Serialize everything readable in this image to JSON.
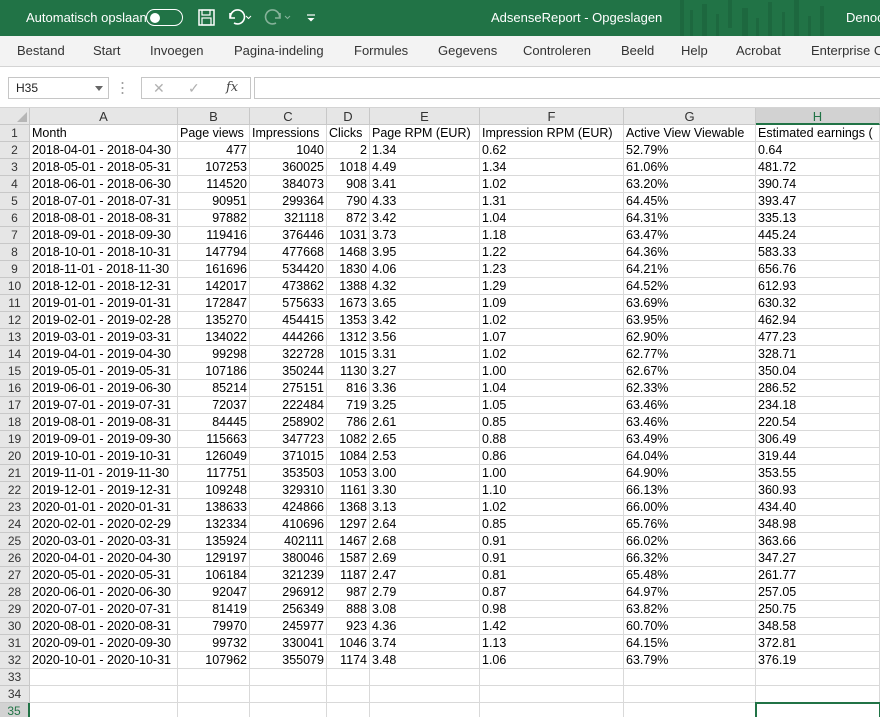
{
  "titlebar": {
    "autosave_label": "Automatisch opslaan",
    "autosave_state": "off",
    "title": "AdsenseReport  -  Opgeslagen",
    "user": "Denoc",
    "icons": [
      "save-icon",
      "undo-icon",
      "redo-icon",
      "customize-quick-access-icon"
    ],
    "color": "#217346"
  },
  "ribbon": {
    "tabs": [
      "Bestand",
      "Start",
      "Invoegen",
      "Pagina-indeling",
      "Formules",
      "Gegevens",
      "Controleren",
      "Beeld",
      "Help",
      "Acrobat",
      "Enterprise C"
    ]
  },
  "formula_bar": {
    "name_box": "H35",
    "cancel_symbol": "✕",
    "enter_symbol": "✓",
    "fx_symbol": "fx",
    "content": ""
  },
  "sheet": {
    "selected_cell": "H35",
    "columns": [
      "A",
      "B",
      "C",
      "D",
      "E",
      "F",
      "G",
      "H"
    ],
    "row_numbers": [
      "1",
      "2",
      "3",
      "4",
      "5",
      "6",
      "7",
      "8",
      "9",
      "10",
      "11",
      "12",
      "13",
      "14",
      "15",
      "16",
      "17",
      "18",
      "19",
      "20",
      "21",
      "22",
      "23",
      "24",
      "25",
      "26",
      "27",
      "28",
      "29",
      "30",
      "31",
      "32",
      "33",
      "34",
      "35"
    ],
    "headers": [
      "Month",
      "Page views",
      "Impressions",
      "Clicks",
      "Page RPM (EUR)",
      "Impression RPM (EUR)",
      "Active View Viewable",
      "Estimated earnings ("
    ],
    "rows": [
      [
        "2018-04-01 - 2018-04-30",
        "477",
        "1040",
        "2",
        "1.34",
        "0.62",
        "52.79%",
        "0.64"
      ],
      [
        "2018-05-01 - 2018-05-31",
        "107253",
        "360025",
        "1018",
        "4.49",
        "1.34",
        "61.06%",
        "481.72"
      ],
      [
        "2018-06-01 - 2018-06-30",
        "114520",
        "384073",
        "908",
        "3.41",
        "1.02",
        "63.20%",
        "390.74"
      ],
      [
        "2018-07-01 - 2018-07-31",
        "90951",
        "299364",
        "790",
        "4.33",
        "1.31",
        "64.45%",
        "393.47"
      ],
      [
        "2018-08-01 - 2018-08-31",
        "97882",
        "321118",
        "872",
        "3.42",
        "1.04",
        "64.31%",
        "335.13"
      ],
      [
        "2018-09-01 - 2018-09-30",
        "119416",
        "376446",
        "1031",
        "3.73",
        "1.18",
        "63.47%",
        "445.24"
      ],
      [
        "2018-10-01 - 2018-10-31",
        "147794",
        "477668",
        "1468",
        "3.95",
        "1.22",
        "64.36%",
        "583.33"
      ],
      [
        "2018-11-01 - 2018-11-30",
        "161696",
        "534420",
        "1830",
        "4.06",
        "1.23",
        "64.21%",
        "656.76"
      ],
      [
        "2018-12-01 - 2018-12-31",
        "142017",
        "473862",
        "1388",
        "4.32",
        "1.29",
        "64.52%",
        "612.93"
      ],
      [
        "2019-01-01 - 2019-01-31",
        "172847",
        "575633",
        "1673",
        "3.65",
        "1.09",
        "63.69%",
        "630.32"
      ],
      [
        "2019-02-01 - 2019-02-28",
        "135270",
        "454415",
        "1353",
        "3.42",
        "1.02",
        "63.95%",
        "462.94"
      ],
      [
        "2019-03-01 - 2019-03-31",
        "134022",
        "444266",
        "1312",
        "3.56",
        "1.07",
        "62.90%",
        "477.23"
      ],
      [
        "2019-04-01 - 2019-04-30",
        "99298",
        "322728",
        "1015",
        "3.31",
        "1.02",
        "62.77%",
        "328.71"
      ],
      [
        "2019-05-01 - 2019-05-31",
        "107186",
        "350244",
        "1130",
        "3.27",
        "1.00",
        "62.67%",
        "350.04"
      ],
      [
        "2019-06-01 - 2019-06-30",
        "85214",
        "275151",
        "816",
        "3.36",
        "1.04",
        "62.33%",
        "286.52"
      ],
      [
        "2019-07-01 - 2019-07-31",
        "72037",
        "222484",
        "719",
        "3.25",
        "1.05",
        "63.46%",
        "234.18"
      ],
      [
        "2019-08-01 - 2019-08-31",
        "84445",
        "258902",
        "786",
        "2.61",
        "0.85",
        "63.46%",
        "220.54"
      ],
      [
        "2019-09-01 - 2019-09-30",
        "115663",
        "347723",
        "1082",
        "2.65",
        "0.88",
        "63.49%",
        "306.49"
      ],
      [
        "2019-10-01 - 2019-10-31",
        "126049",
        "371015",
        "1084",
        "2.53",
        "0.86",
        "64.04%",
        "319.44"
      ],
      [
        "2019-11-01 - 2019-11-30",
        "117751",
        "353503",
        "1053",
        "3.00",
        "1.00",
        "64.90%",
        "353.55"
      ],
      [
        "2019-12-01 - 2019-12-31",
        "109248",
        "329310",
        "1161",
        "3.30",
        "1.10",
        "66.13%",
        "360.93"
      ],
      [
        "2020-01-01 - 2020-01-31",
        "138633",
        "424866",
        "1368",
        "3.13",
        "1.02",
        "66.00%",
        "434.40"
      ],
      [
        "2020-02-01 - 2020-02-29",
        "132334",
        "410696",
        "1297",
        "2.64",
        "0.85",
        "65.76%",
        "348.98"
      ],
      [
        "2020-03-01 - 2020-03-31",
        "135924",
        "402111",
        "1467",
        "2.68",
        "0.91",
        "66.02%",
        "363.66"
      ],
      [
        "2020-04-01 - 2020-04-30",
        "129197",
        "380046",
        "1587",
        "2.69",
        "0.91",
        "66.32%",
        "347.27"
      ],
      [
        "2020-05-01 - 2020-05-31",
        "106184",
        "321239",
        "1187",
        "2.47",
        "0.81",
        "65.48%",
        "261.77"
      ],
      [
        "2020-06-01 - 2020-06-30",
        "92047",
        "296912",
        "987",
        "2.79",
        "0.87",
        "64.97%",
        "257.05"
      ],
      [
        "2020-07-01 - 2020-07-31",
        "81419",
        "256349",
        "888",
        "3.08",
        "0.98",
        "63.82%",
        "250.75"
      ],
      [
        "2020-08-01 - 2020-08-31",
        "79970",
        "245977",
        "923",
        "4.36",
        "1.42",
        "60.70%",
        "348.58"
      ],
      [
        "2020-09-01 - 2020-09-30",
        "99732",
        "330041",
        "1046",
        "3.74",
        "1.13",
        "64.15%",
        "372.81"
      ],
      [
        "2020-10-01 - 2020-10-31",
        "107962",
        "355079",
        "1174",
        "3.48",
        "1.06",
        "63.79%",
        "376.19"
      ]
    ]
  }
}
